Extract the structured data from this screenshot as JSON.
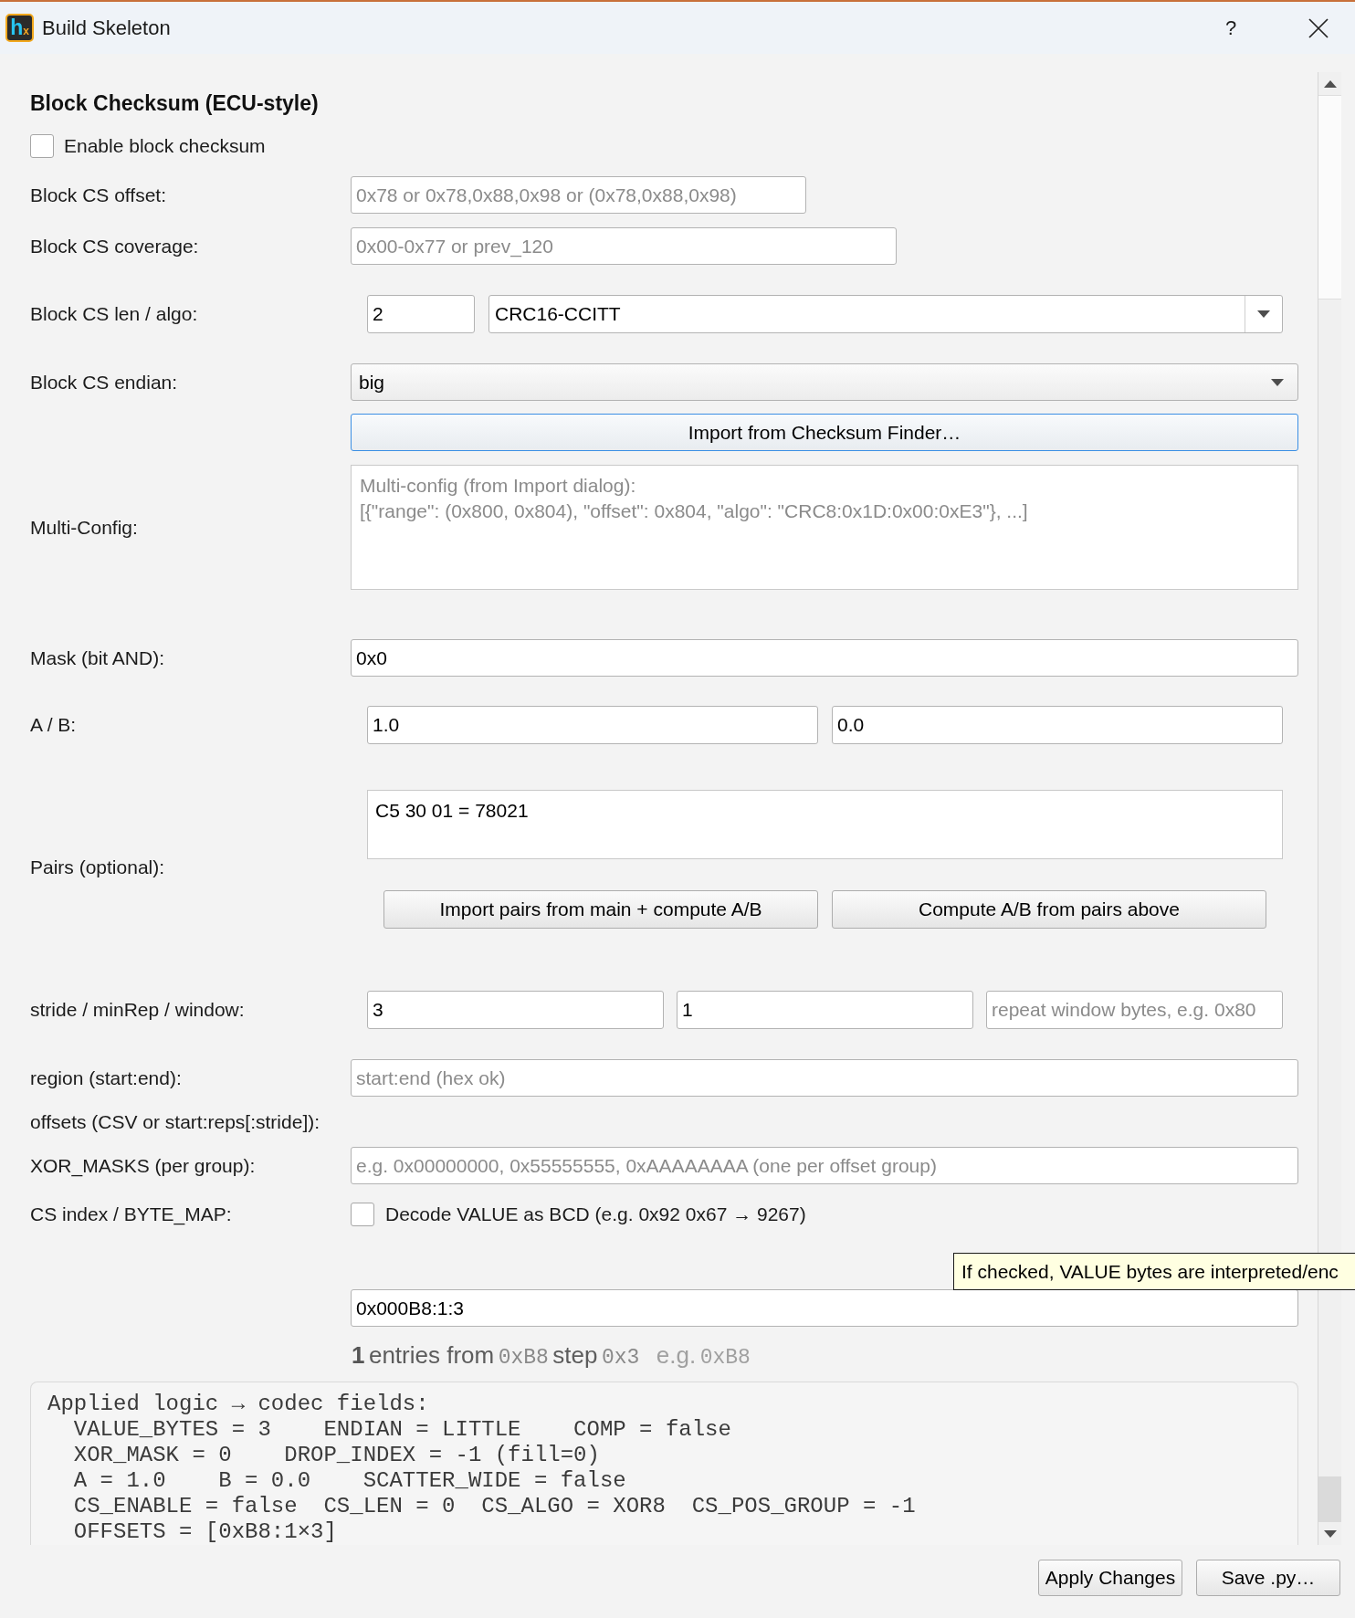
{
  "window": {
    "title": "Build Skeleton",
    "app_icon_text": "h$_{x}$",
    "help_button": "?"
  },
  "heading": "Block Checksum (ECU-style)",
  "enable_block_checksum": {
    "label": "Enable block checksum",
    "checked": false
  },
  "block_cs_offset": {
    "label": "Block CS offset:",
    "placeholder": "0x78 or 0x78,0x88,0x98 or (0x78,0x88,0x98)"
  },
  "block_cs_coverage": {
    "label": "Block CS coverage:",
    "placeholder": "0x00-0x77 or prev_120"
  },
  "block_cs_len_algo": {
    "label": "Block CS len / algo:",
    "len": {
      "value": "2"
    },
    "algo": {
      "value": "CRC16-CCITT"
    }
  },
  "block_cs_endian": {
    "label": "Block CS endian:",
    "value": "big"
  },
  "import_button": {
    "label": "Import from Checksum Finder…",
    "focused": true
  },
  "multi_config": {
    "label": "Multi-Config:",
    "placeholder": "Multi-config (from Import dialog):\n[{\"range\": (0x800, 0x804), \"offset\": 0x804, \"algo\": \"CRC8:0x1D:0x00:0xE3\"}, ...]"
  },
  "mask": {
    "label": "Mask (bit AND):",
    "value": "0x0"
  },
  "a_b": {
    "label": "A / B:",
    "a": {
      "value": "1.0"
    },
    "b": {
      "value": "0.0"
    }
  },
  "pairs": {
    "label": "Pairs (optional):",
    "value": "C5 30 01 = 78021",
    "buttons": [
      {
        "label": "Import pairs from main + compute A/B"
      },
      {
        "label": "Compute A/B from pairs above"
      }
    ]
  },
  "stride_minrep_window": {
    "label": "stride / minRep / window:",
    "fields": [
      {
        "value": "3"
      },
      {
        "value": "1"
      },
      {
        "placeholder": "repeat window bytes, e.g. 0x80"
      }
    ]
  },
  "region": {
    "label": "region (start:end):",
    "placeholder": "start:end (hex ok)"
  },
  "offsets": {
    "label": "offsets (CSV or start:reps[:stride]):"
  },
  "xor_masks": {
    "label": "XOR_MASKS (per group):",
    "placeholder": "e.g. 0x00000000, 0x55555555, 0xAAAAAAAA (one per offset group)"
  },
  "cs_index_byte_map": {
    "label": "CS index / BYTE_MAP:",
    "bcd_checkbox": {
      "label": "Decode VALUE as BCD (e.g. 0x92 0x67 → 9267)",
      "checked": false
    }
  },
  "tooltip": {
    "text": "If checked, VALUE bytes are interpreted/enc"
  },
  "offsets_field": {
    "value": "0x000B8:1:3"
  },
  "offsets_summary": [
    {
      "kind": "count",
      "text": "1"
    },
    {
      "kind": "word",
      "text": "entries from"
    },
    {
      "kind": "code",
      "text": "0xB8"
    },
    {
      "kind": "word",
      "text": "step"
    },
    {
      "kind": "code",
      "text": "0x3"
    },
    {
      "kind": "hint",
      "text": "e.g."
    },
    {
      "kind": "hint_code",
      "text": "0xB8"
    }
  ],
  "applied_logic": {
    "lines": [
      "Applied logic → codec fields:",
      "  VALUE_BYTES = 3    ENDIAN = LITTLE    COMP = false",
      "  XOR_MASK = 0    DROP_INDEX = -1 (fill=0)",
      "  A = 1.0    B = 0.0    SCATTER_WIDE = false",
      "  CS_ENABLE = false  CS_LEN = 0  CS_ALGO = XOR8  CS_POS_GROUP = -1",
      "  OFFSETS = [0xB8:1×3]"
    ]
  },
  "footer_buttons": [
    {
      "label": "Apply Changes"
    },
    {
      "label": "Save .py…"
    }
  ]
}
